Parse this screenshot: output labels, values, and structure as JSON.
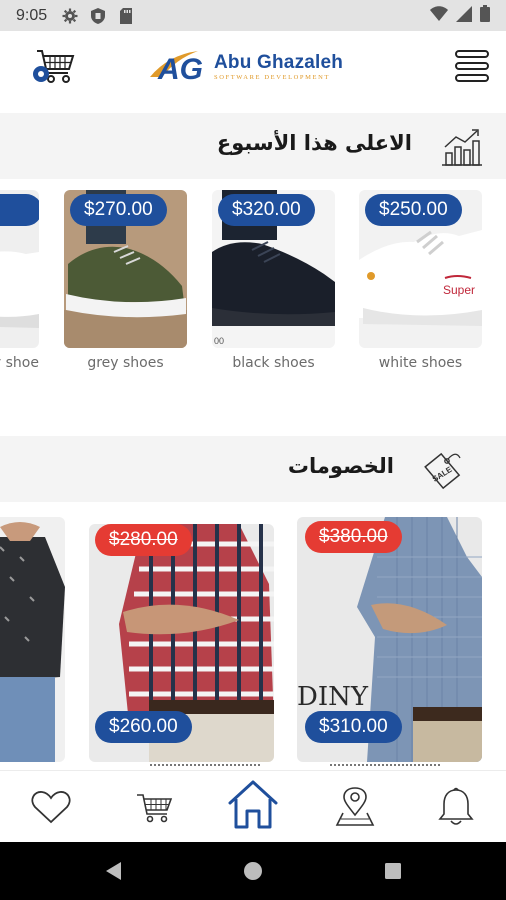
{
  "status_bar": {
    "time": "9:05",
    "icons": [
      "gear-icon",
      "shield-icon",
      "sd-card-icon",
      "wifi-icon",
      "signal-icon",
      "battery-icon"
    ]
  },
  "header": {
    "logo_initials": "AG",
    "logo_name": "Abu Ghazaleh",
    "logo_tagline": "SOFTWARE DEVELOPMENT",
    "icons": [
      "cart-icon",
      "menu-icon"
    ]
  },
  "top_week": {
    "title": "الاعلى هذا الأسبوع",
    "icon": "trending-chart-icon",
    "products": [
      {
        "name": "white shoes",
        "price": "$250.00",
        "image": "white-sneaker"
      },
      {
        "name": "black shoes",
        "price": "$320.00",
        "image": "black-shoe"
      },
      {
        "name": "grey shoes",
        "price": "$270.00",
        "image": "green-shoe"
      },
      {
        "name": "y shoe",
        "price": "",
        "image": "white-sneaker-partial"
      }
    ]
  },
  "discounts": {
    "title": "الخصومات",
    "icon": "sale-tag-icon",
    "products": [
      {
        "old_price": "$380.00",
        "price": "$310.00",
        "image": "blue-check-shirt"
      },
      {
        "old_price": "$280.00",
        "price": "$260.00",
        "image": "red-plaid-shirt"
      },
      {
        "old_price": "",
        "price": "",
        "image": "dark-print-shirt-partial"
      }
    ]
  },
  "bottom_nav": {
    "items": [
      "heart-icon",
      "cart-icon",
      "home-icon",
      "location-icon",
      "bell-icon"
    ],
    "active": "home-icon"
  },
  "colors": {
    "brand_blue": "#1f4f9c",
    "brand_orange": "#e09a2a",
    "sale_red": "#e53b33",
    "section_bg": "#f4f4f4"
  }
}
